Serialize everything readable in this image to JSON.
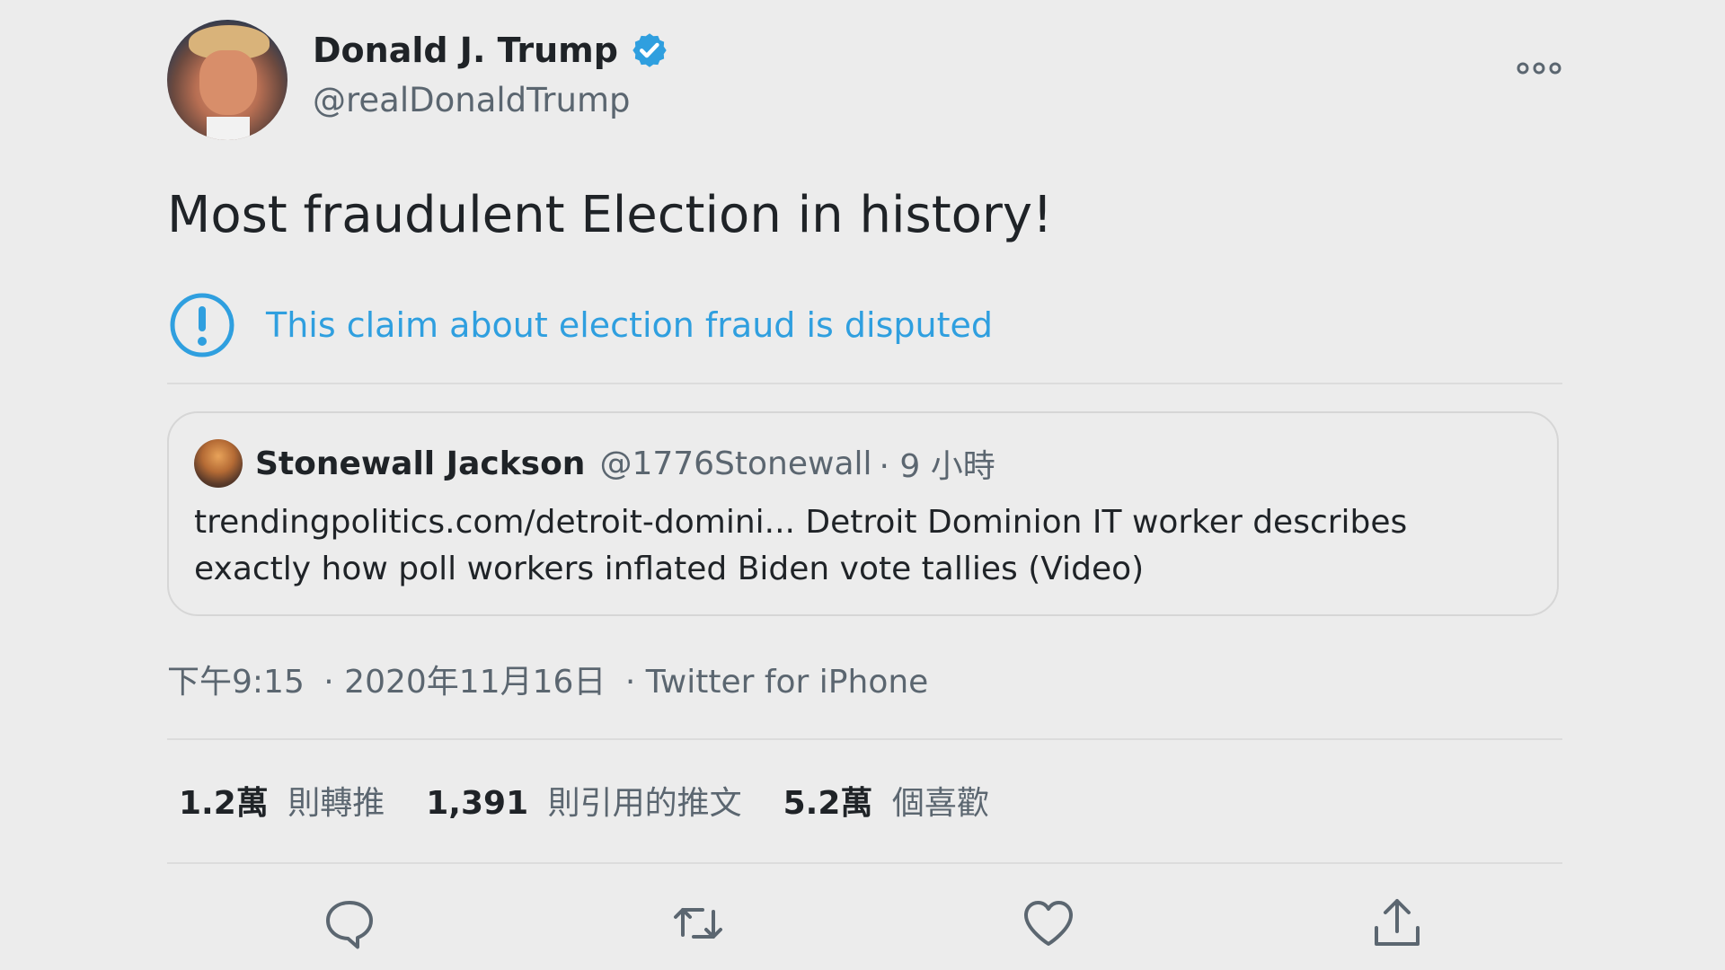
{
  "author": {
    "name": "Donald J. Trump",
    "handle": "@realDonaldTrump"
  },
  "tweet": {
    "text": "Most fraudulent Election in history!",
    "dispute_notice": "This claim about election fraud is disputed"
  },
  "quote": {
    "name": "Stonewall Jackson",
    "handle": "@1776Stonewall",
    "time": "· 9 小時",
    "body": "trendingpolitics.com/detroit-domini...  Detroit Dominion IT worker describes exactly how poll workers inflated Biden vote tallies (Video)"
  },
  "meta": {
    "time": "下午9:15",
    "date": "· 2020年11月16日",
    "source": "· Twitter for iPhone"
  },
  "stats": {
    "retweets": {
      "count": "1.2萬",
      "label": "則轉推"
    },
    "quotes": {
      "count": "1,391",
      "label": "則引用的推文"
    },
    "likes": {
      "count": "5.2萬",
      "label": "個喜歡"
    }
  },
  "icons": {
    "verified": "verified-badge-icon",
    "more": "more-icon",
    "dispute": "alert-circle-icon",
    "reply": "reply-icon",
    "retweet": "retweet-icon",
    "like": "heart-icon",
    "share": "share-icon"
  },
  "colors": {
    "background": "#ececec",
    "accent": "#2f9fdf",
    "text": "#1f2327",
    "secondary": "#5b6670"
  }
}
